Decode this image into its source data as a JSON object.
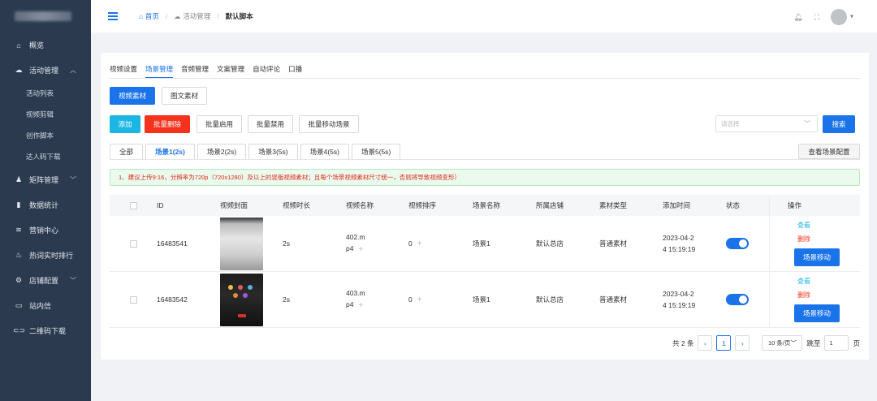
{
  "sidebar": {
    "items": [
      {
        "label": "概览",
        "icon": "home-icon"
      },
      {
        "label": "活动管理",
        "icon": "cloud-icon"
      },
      {
        "label": "矩阵管理",
        "icon": "user-icon"
      },
      {
        "label": "数据统计",
        "icon": "bar-chart-icon"
      },
      {
        "label": "营销中心",
        "icon": "layers-icon"
      },
      {
        "label": "热词实时排行",
        "icon": "fire-icon"
      },
      {
        "label": "店铺配置",
        "icon": "settings-icon"
      },
      {
        "label": "站内信",
        "icon": "message-icon"
      },
      {
        "label": "二维码下载",
        "icon": "link-icon"
      }
    ],
    "sub_items": [
      "活动列表",
      "视频剪辑",
      "创作脚本",
      "达人码下载"
    ]
  },
  "header": {
    "breadcrumb": [
      "首页",
      "活动管理",
      "默认脚本"
    ]
  },
  "top_tabs": [
    "视频设置",
    "场景管理",
    "音频管理",
    "文案管理",
    "自动评论",
    "口播"
  ],
  "material_tabs": [
    "视频素材",
    "图文素材"
  ],
  "actions": {
    "add": "添加",
    "batch_delete": "批量删除",
    "batch_enable": "批量启用",
    "batch_disable": "批量禁用",
    "batch_move": "批量移动场景",
    "select_placeholder": "请选择",
    "search": "搜索",
    "view_scene_config": "查看场景配置"
  },
  "scene_tabs": [
    "全部",
    "场景1(2s)",
    "场景2(2s)",
    "场景3(5s)",
    "场景4(5s)",
    "场景5(5s)"
  ],
  "notice": "1、建议上传9:16，分辨率为720p（720x1280）及以上的竖版视频素材；且每个场景视频素材尺寸统一，否则将导致视频变形）",
  "table": {
    "headers": [
      "ID",
      "视频封面",
      "视频时长",
      "视频名称",
      "视频排序",
      "场景名称",
      "所属店铺",
      "素材类型",
      "添加时间",
      "状态",
      "操作"
    ],
    "rows": [
      {
        "id": "16483541",
        "duration": "2s",
        "name_line1": "402.m",
        "name_line2": "p4",
        "sort": "0",
        "scene": "场景1",
        "store": "默认总店",
        "type": "普通素材",
        "time_line1": "2023-04-2",
        "time_line2": "4 15:19:19",
        "status": "on"
      },
      {
        "id": "16483542",
        "duration": "2s",
        "name_line1": "403.m",
        "name_line2": "p4",
        "sort": "0",
        "scene": "场景1",
        "store": "默认总店",
        "type": "普通素材",
        "time_line1": "2023-04-2",
        "time_line2": "4 15:19:19",
        "status": "on"
      }
    ],
    "ops": {
      "view": "查看",
      "delete": "删除",
      "move": "场景移动"
    }
  },
  "pagination": {
    "total": "共 2 条",
    "prev": "‹",
    "page": "1",
    "next": "›",
    "page_size": "10 条/页",
    "jump_label": "跳至",
    "jump_value": "1",
    "page_suffix": "页"
  },
  "colors": {
    "sidebar": "#2b3a4f",
    "primary": "#1a73e8",
    "danger": "#f5321c",
    "cyan": "#1cb6e5"
  }
}
